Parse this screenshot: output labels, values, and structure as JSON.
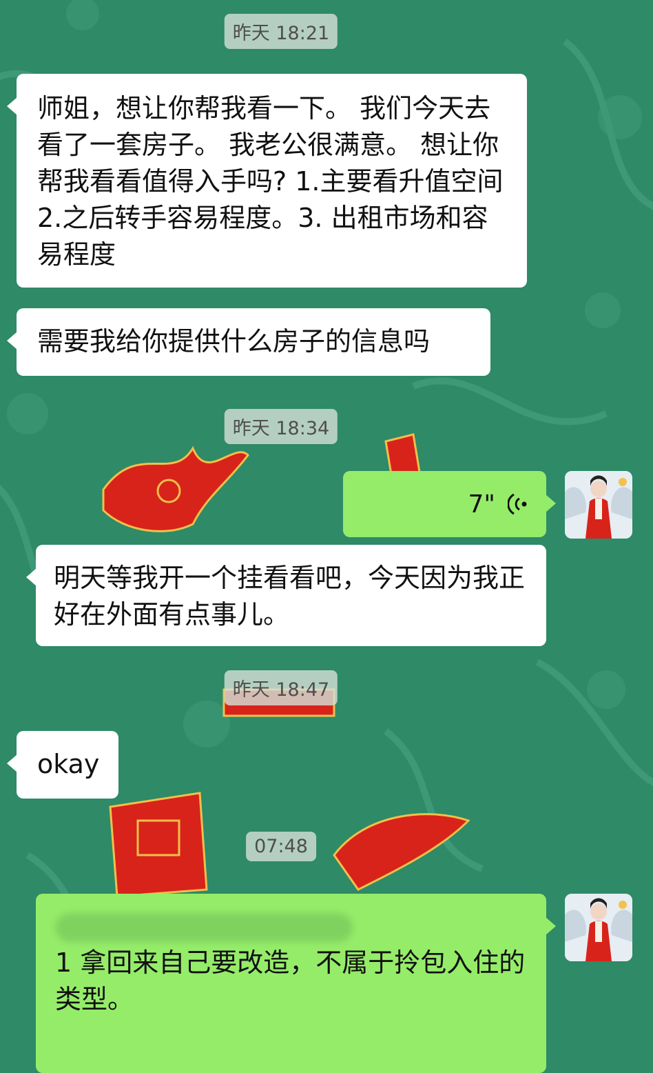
{
  "chat": {
    "timestamps": [
      "昨天 18:21",
      "昨天 18:34",
      "昨天 18:47",
      "07:48"
    ],
    "messages": [
      {
        "side": "left",
        "text": "师姐，想让你帮我看一下。 我们今天去看了一套房子。 我老公很满意。 想让你帮我看看值得入手吗? 1.主要看升值空间 2.之后转手容易程度。3. 出租市场和容易程度"
      },
      {
        "side": "left",
        "text": "需要我给你提供什么房子的信息吗"
      },
      {
        "side": "right",
        "type": "voice",
        "duration": "7\"",
        "icon": "voice-wave-icon"
      },
      {
        "side": "left",
        "text": "明天等我开一个挂看看吧，今天因为我正好在外面有点事儿。"
      },
      {
        "side": "left",
        "text": "okay"
      },
      {
        "side": "right",
        "text": "1 拿回来自己要改造，不属于拎包入住的类型。"
      }
    ]
  },
  "colors": {
    "background": "#2e8a67",
    "bubble_left": "#ffffff",
    "bubble_right": "#95ec69",
    "decoration_red": "#d8231b"
  }
}
